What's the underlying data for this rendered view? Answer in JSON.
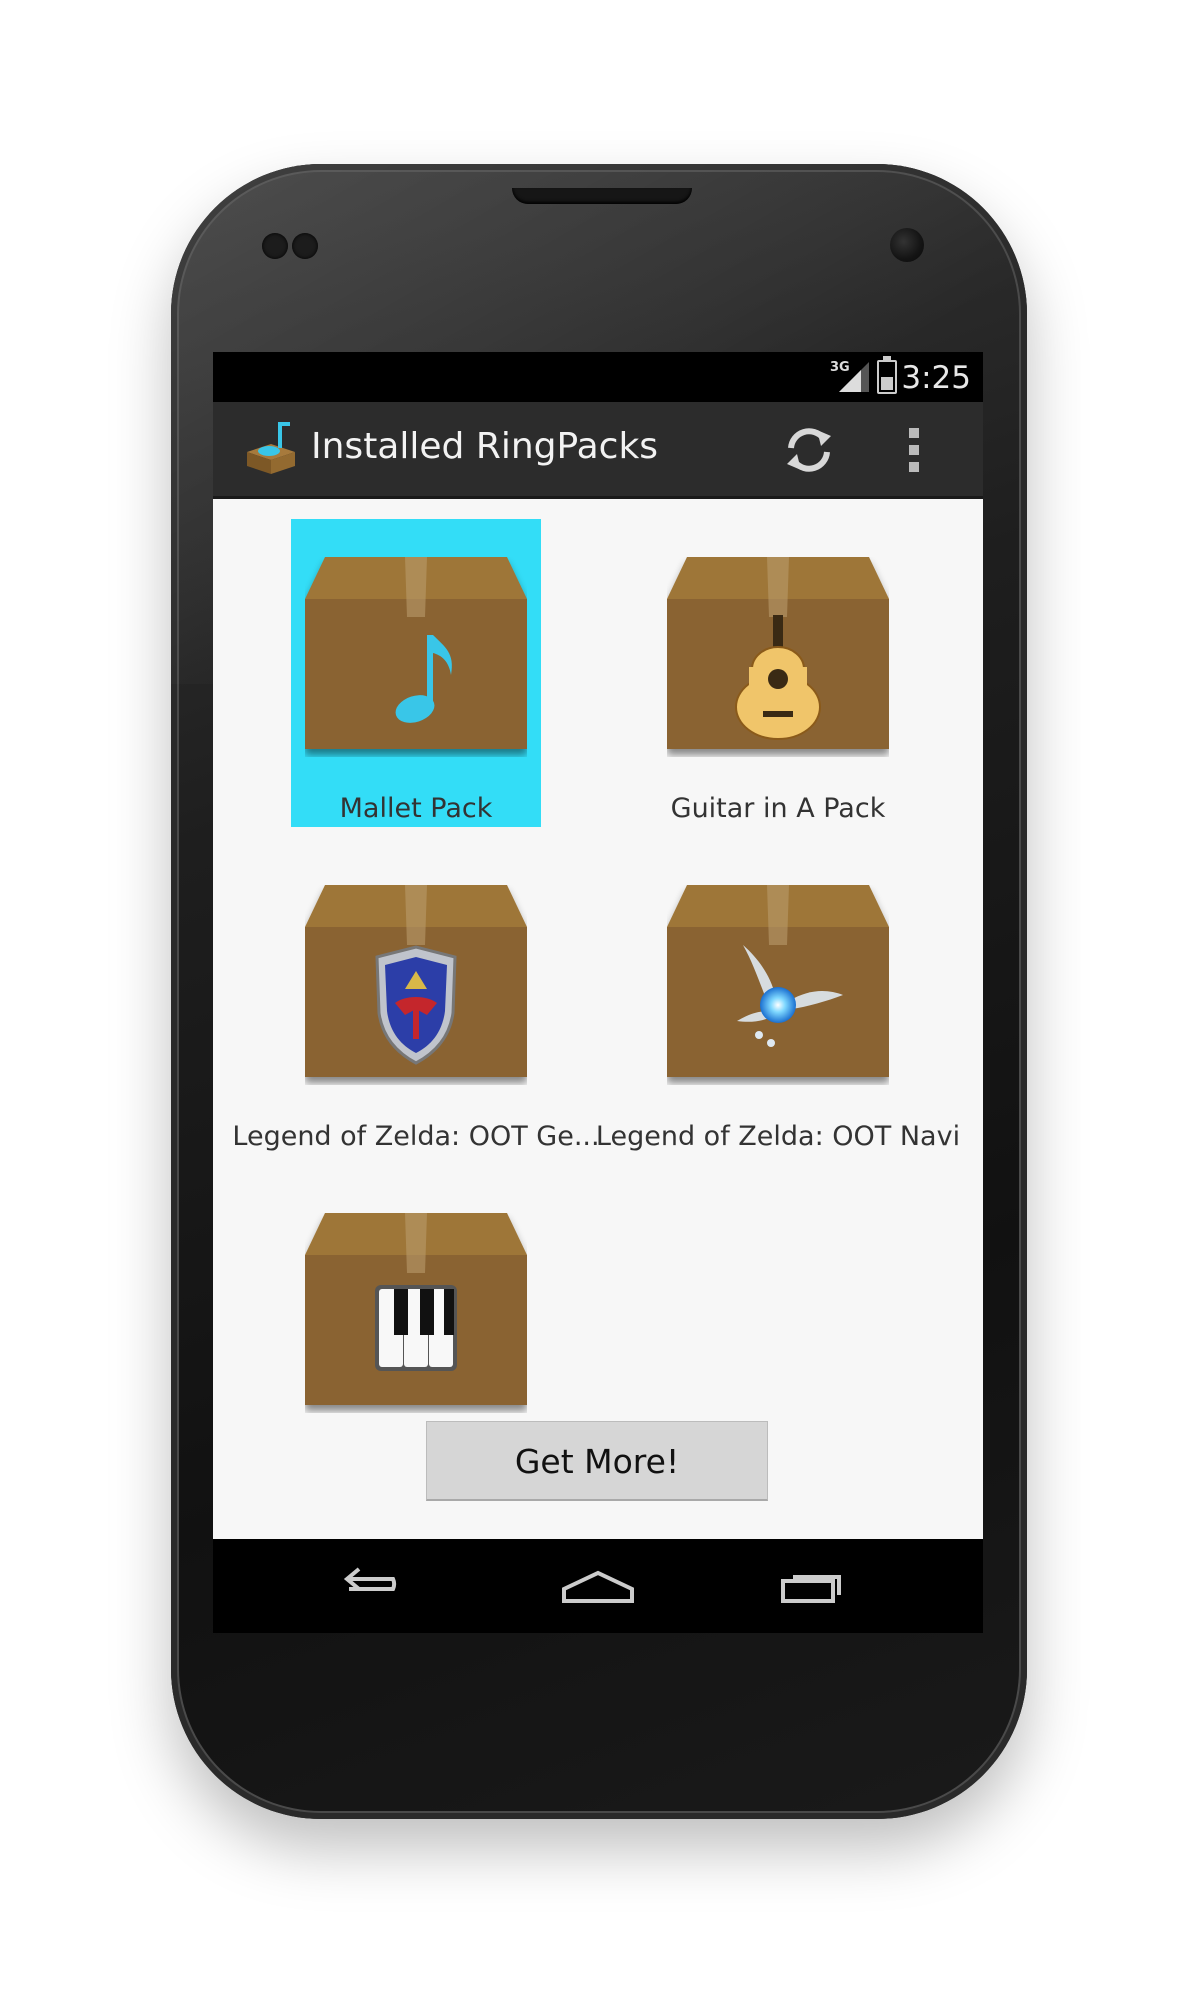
{
  "status_bar": {
    "network": "3G",
    "time": "3:25"
  },
  "action_bar": {
    "title": "Installed RingPacks",
    "refresh_icon": "refresh-icon",
    "overflow_icon": "overflow-menu-icon"
  },
  "packs": [
    {
      "label": "Mallet Pack",
      "icon": "music-note-icon",
      "selected": true
    },
    {
      "label": "Guitar in A Pack",
      "icon": "guitar-icon",
      "selected": false
    },
    {
      "label": "Legend of Zelda: OOT Ge...",
      "icon": "hylian-shield-icon",
      "selected": false
    },
    {
      "label": "Legend of Zelda: OOT Navi",
      "icon": "fairy-icon",
      "selected": false
    },
    {
      "label": "",
      "icon": "piano-keys-icon",
      "selected": false
    }
  ],
  "get_more_label": "Get More!",
  "nav": {
    "back": "back-icon",
    "home": "home-icon",
    "recents": "recents-icon"
  },
  "colors": {
    "selected": "#33ddf7",
    "box": "#8a6430",
    "action_bar": "#2c2c2c",
    "content_bg": "#f7f7f7"
  }
}
